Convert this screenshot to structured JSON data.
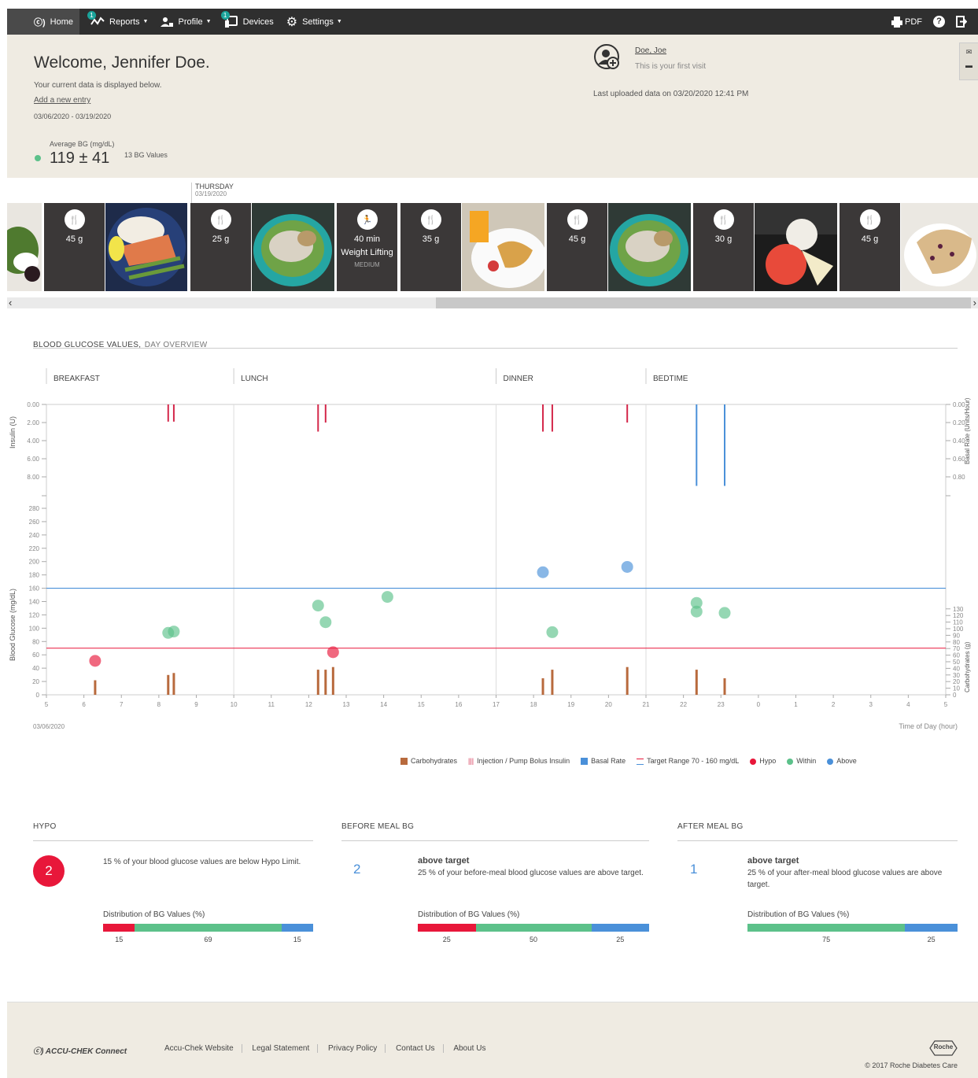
{
  "nav": {
    "home": "Home",
    "reports": "Reports",
    "profile": "Profile",
    "devices": "Devices",
    "settings": "Settings",
    "reports_badge": "1",
    "devices_badge": "1",
    "pdf": "PDF"
  },
  "header": {
    "welcome": "Welcome, Jennifer Doe.",
    "subtitle": "Your current data is displayed below.",
    "add_entry": "Add a new entry",
    "date_range": "03/06/2020 - 03/19/2020",
    "avg_label": "Average BG (mg/dL)",
    "avg_value": "119 ± 41",
    "bg_count": "13 BG Values",
    "patient_name": "Doe, Joe",
    "first_visit": "This is your first visit",
    "last_upload": "Last uploaded data on 03/20/2020 12:41 PM"
  },
  "feed": {
    "day": "THURSDAY",
    "date": "03/19/2020",
    "tiles": [
      {
        "value": "45 g",
        "type": "meal"
      },
      {
        "value": "25 g",
        "type": "meal"
      },
      {
        "value": "40 min",
        "line2": "Weight Lifting",
        "line3": "MEDIUM",
        "type": "exercise"
      },
      {
        "value": "35 g",
        "type": "meal"
      },
      {
        "value": "45 g",
        "type": "meal"
      },
      {
        "value": "30 g",
        "type": "meal"
      },
      {
        "value": "45 g",
        "type": "meal"
      }
    ],
    "scroll_left": "‹",
    "scroll_right": "›"
  },
  "chart": {
    "title_main": "BLOOD GLUCOSE VALUES,",
    "title_sub": "DAY OVERVIEW",
    "periods": [
      "BREAKFAST",
      "LUNCH",
      "DINNER",
      "BEDTIME"
    ],
    "insulin_axis_label": "Insulin (U)",
    "bg_axis_label": "Blood Glucose (mg/dL)",
    "basal_axis_label": "Basal Rate (Units/Hour)",
    "carb_axis_label": "Carbohydrates (g)",
    "start_date": "03/06/2020",
    "x_title": "Time of Day (hour)",
    "legend": {
      "carbs": "Carbohydrates",
      "bolus": "Injection / Pump Bolus Insulin",
      "basal": "Basal Rate",
      "target": "Target Range 70 - 160 mg/dL",
      "hypo": "Hypo",
      "within": "Within",
      "above": "Above"
    }
  },
  "chart_data": {
    "type": "scatter",
    "x_ticks": [
      "5",
      "6",
      "7",
      "8",
      "9",
      "10",
      "11",
      "12",
      "13",
      "14",
      "15",
      "16",
      "17",
      "18",
      "19",
      "20",
      "21",
      "22",
      "23",
      "0",
      "1",
      "2",
      "3",
      "4",
      "5"
    ],
    "insulin_ticks": [
      "0.00",
      "2.00",
      "4.00",
      "6.00",
      "8.00"
    ],
    "basal_ticks": [
      "0.00",
      "0.20",
      "0.40",
      "0.60",
      "0.80"
    ],
    "bg_ticks": [
      "0",
      "20",
      "40",
      "60",
      "80",
      "100",
      "120",
      "140",
      "160",
      "180",
      "200",
      "220",
      "240",
      "260",
      "280"
    ],
    "carb_ticks": [
      "0",
      "10",
      "20",
      "30",
      "40",
      "50",
      "60",
      "70",
      "80",
      "90",
      "100",
      "110",
      "120",
      "130"
    ],
    "target_low": 70,
    "target_high": 160,
    "bg_points": [
      {
        "x": 6.3,
        "y": 51,
        "status": "hypo"
      },
      {
        "x": 8.25,
        "y": 93,
        "status": "within"
      },
      {
        "x": 8.4,
        "y": 95,
        "status": "within"
      },
      {
        "x": 12.25,
        "y": 134,
        "status": "within"
      },
      {
        "x": 12.45,
        "y": 109,
        "status": "within"
      },
      {
        "x": 12.65,
        "y": 64,
        "status": "hypo"
      },
      {
        "x": 14.1,
        "y": 147,
        "status": "within"
      },
      {
        "x": 18.25,
        "y": 184,
        "status": "above"
      },
      {
        "x": 18.5,
        "y": 94,
        "status": "within"
      },
      {
        "x": 20.5,
        "y": 192,
        "status": "above"
      },
      {
        "x": 22.35,
        "y": 138,
        "status": "within"
      },
      {
        "x": 22.35,
        "y": 125,
        "status": "within"
      },
      {
        "x": 23.1,
        "y": 123,
        "status": "within"
      }
    ],
    "carbs": [
      {
        "x": 6.3,
        "y": 22
      },
      {
        "x": 8.25,
        "y": 30
      },
      {
        "x": 8.4,
        "y": 33
      },
      {
        "x": 12.25,
        "y": 38
      },
      {
        "x": 12.45,
        "y": 38
      },
      {
        "x": 12.65,
        "y": 42
      },
      {
        "x": 18.25,
        "y": 25
      },
      {
        "x": 18.5,
        "y": 38
      },
      {
        "x": 20.5,
        "y": 42
      },
      {
        "x": 22.35,
        "y": 38
      },
      {
        "x": 23.1,
        "y": 25
      }
    ],
    "bolus": [
      {
        "x": 8.25,
        "y": 1.9
      },
      {
        "x": 8.4,
        "y": 1.9
      },
      {
        "x": 12.25,
        "y": 3.0
      },
      {
        "x": 12.45,
        "y": 2.0
      },
      {
        "x": 18.25,
        "y": 3.0
      },
      {
        "x": 18.5,
        "y": 3.0
      },
      {
        "x": 20.5,
        "y": 2.0
      }
    ],
    "basal": [
      {
        "x": 22.35,
        "y": 0.9
      },
      {
        "x": 23.1,
        "y": 0.9
      }
    ]
  },
  "stats": {
    "hypo": {
      "title": "HYPO",
      "count": "2",
      "text": "15 % of your blood glucose values are below Hypo Limit.",
      "dist_label": "Distribution of BG Values (%)",
      "segments": [
        {
          "value": 15,
          "label": "15",
          "color": "#e8173a"
        },
        {
          "value": 69,
          "label": "69",
          "color": "#5cc18a"
        },
        {
          "value": 15,
          "label": "15",
          "color": "#4a90d9"
        }
      ]
    },
    "before": {
      "title": "BEFORE MEAL BG",
      "count": "2",
      "heading": "above target",
      "text": "25 % of your before-meal blood glucose values are above target.",
      "dist_label": "Distribution of BG Values (%)",
      "segments": [
        {
          "value": 25,
          "label": "25",
          "color": "#e8173a"
        },
        {
          "value": 50,
          "label": "50",
          "color": "#5cc18a"
        },
        {
          "value": 25,
          "label": "25",
          "color": "#4a90d9"
        }
      ]
    },
    "after": {
      "title": "AFTER MEAL BG",
      "count": "1",
      "heading": "above target",
      "text": "25 % of your after-meal blood glucose values are above target.",
      "dist_label": "Distribution of BG Values (%)",
      "segments": [
        {
          "value": 75,
          "label": "75",
          "color": "#5cc18a"
        },
        {
          "value": 25,
          "label": "25",
          "color": "#4a90d9"
        }
      ]
    }
  },
  "footer": {
    "brand": "ACCU-CHEK Connect",
    "links": [
      "Accu-Chek Website",
      "Legal Statement",
      "Privacy Policy",
      "Contact Us",
      "About Us"
    ],
    "roche": "Roche",
    "copyright": "© 2017 Roche Diabetes Care"
  },
  "colors": {
    "hypo": "#e8173a",
    "within": "#5cc18a",
    "above": "#4a90d9",
    "carbs": "#b86a3d",
    "bolus": "#d4274a",
    "basal": "#4a90d9"
  }
}
